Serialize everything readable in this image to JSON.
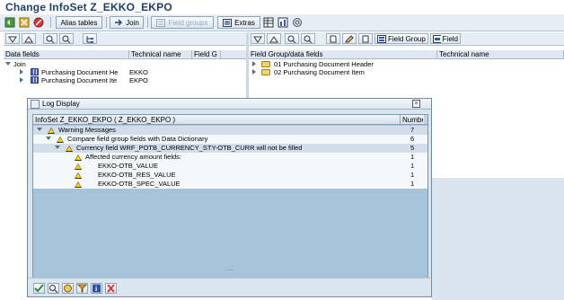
{
  "window": {
    "title": "Change InfoSet Z_EKKO_EKPO"
  },
  "toolbar": {
    "alias_tables": "Alias tables",
    "join": "Join",
    "field_groups": "Field groups",
    "extras": "Extras"
  },
  "left_panel": {
    "columns": [
      "Data fields",
      "Technical name",
      "Field G"
    ],
    "root": "Join",
    "items": [
      {
        "label": "Purchasing Document He",
        "tech": "EKKO"
      },
      {
        "label": "Purchasing Document Ite",
        "tech": "EKPO"
      }
    ]
  },
  "right_panel": {
    "field_group_btn": "Field Group",
    "field_btn": "Field",
    "columns": [
      "Field Group/data fields",
      "Technical name"
    ],
    "items": [
      {
        "label": "01 Purchasing Document Header"
      },
      {
        "label": "02 Purchasing Document Item"
      }
    ]
  },
  "dialog": {
    "title": "Log Display",
    "close_icon": "close-icon",
    "header": {
      "col1": "InfoSet Z_EKKO_EKPO ( Z_EKKO_EKPO )",
      "col2": "Numbe"
    },
    "rows": [
      {
        "text": "Warning Messages",
        "num": "7"
      },
      {
        "text": "Compare field group fields with Data Dictionary",
        "num": "6"
      },
      {
        "text": "Currency field WRF_POTB_CURRENCY_STY-OTB_CURR will not be filled",
        "num": "5"
      },
      {
        "text": "Affected currency amount fields:",
        "num": "1"
      },
      {
        "text": "EKKO-OTB_VALUE",
        "num": "1"
      },
      {
        "text": "EKKO-OTB_RES_VALUE",
        "num": "1"
      },
      {
        "text": "EKKO-OTB_SPEC_VALUE",
        "num": "1"
      }
    ],
    "grip": "....."
  }
}
